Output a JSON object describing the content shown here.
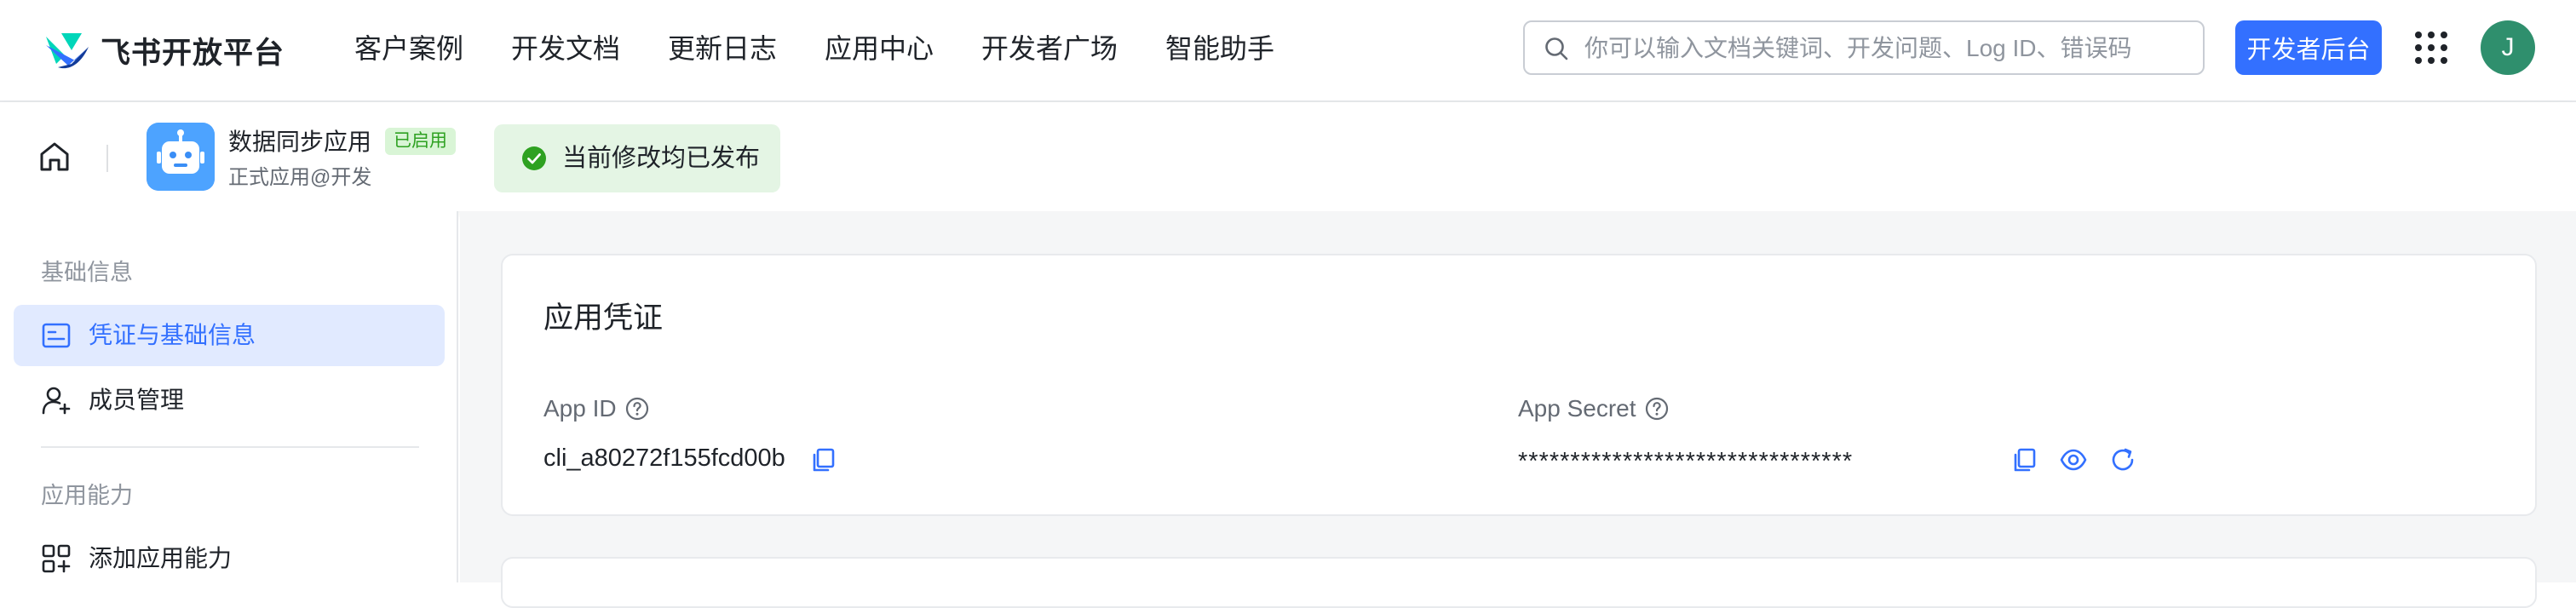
{
  "brand": {
    "name": "飞书开放平台"
  },
  "nav": {
    "links": [
      "客户案例",
      "开发文档",
      "更新日志",
      "应用中心",
      "开发者广场",
      "智能助手"
    ]
  },
  "search": {
    "placeholder": "你可以输入文档关键词、开发问题、Log ID、错误码"
  },
  "header": {
    "console_label": "开发者后台",
    "avatar_initial": "J"
  },
  "app": {
    "name": "数据同步应用",
    "status_badge": "已启用",
    "subtitle": "正式应用@开发",
    "publish_status": "当前修改均已发布"
  },
  "sidebar": {
    "groups": [
      {
        "title": "基础信息",
        "items": [
          {
            "label": "凭证与基础信息",
            "icon": "id-card-icon",
            "active": true
          },
          {
            "label": "成员管理",
            "icon": "user-add-icon",
            "active": false
          }
        ]
      },
      {
        "title": "应用能力",
        "items": [
          {
            "label": "添加应用能力",
            "icon": "grid-add-icon",
            "active": false
          }
        ]
      }
    ]
  },
  "credentials": {
    "title": "应用凭证",
    "app_id_label": "App ID",
    "app_id_value": "cli_a80272f155fcd00b",
    "app_secret_label": "App Secret",
    "app_secret_value": "********************************"
  },
  "colors": {
    "accent": "#3370ff",
    "active_bg": "#e1eaff",
    "success": "#2ea121",
    "success_bg": "#e4f5e4",
    "avatar": "#2f8f6d"
  }
}
